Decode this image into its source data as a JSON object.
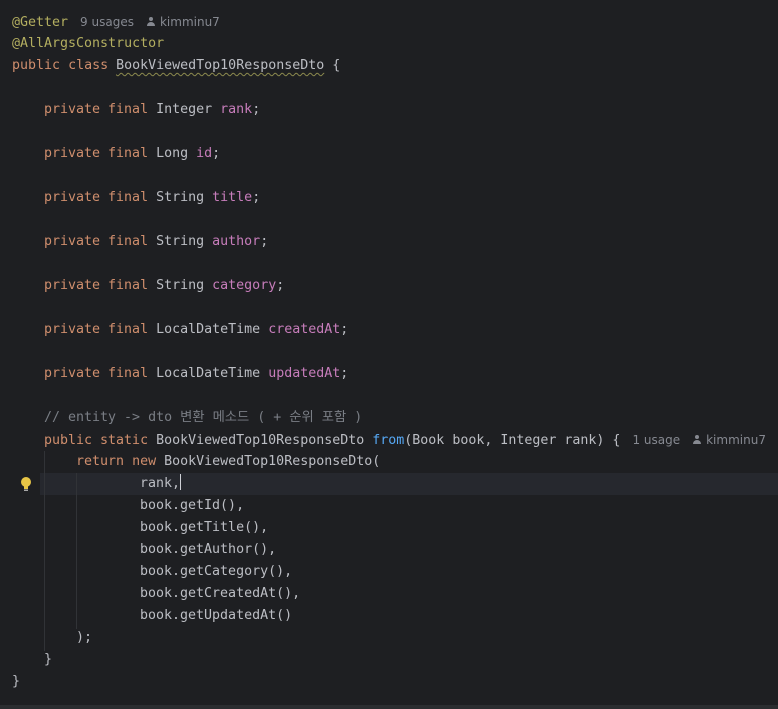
{
  "header": {
    "annotation_getter": "@Getter",
    "getter_usages": "9 usages",
    "getter_author": "kimminu7",
    "annotation_ctor": "@AllArgsConstructor",
    "kw_public": "public",
    "kw_class": "class",
    "class_name": "BookViewedTop10ResponseDto",
    "open_brace": "{"
  },
  "fields": [
    {
      "modifiers": "private final",
      "type": "Integer",
      "name": "rank"
    },
    {
      "modifiers": "private final",
      "type": "Long",
      "name": "id"
    },
    {
      "modifiers": "private final",
      "type": "String",
      "name": "title"
    },
    {
      "modifiers": "private final",
      "type": "String",
      "name": "author"
    },
    {
      "modifiers": "private final",
      "type": "String",
      "name": "category"
    },
    {
      "modifiers": "private final",
      "type": "LocalDateTime",
      "name": "createdAt"
    },
    {
      "modifiers": "private final",
      "type": "LocalDateTime",
      "name": "updatedAt"
    }
  ],
  "method": {
    "comment": "// entity -> dto 변환 메소드 ( + 순위 포함 )",
    "modifiers": "public static",
    "return_type": "BookViewedTop10ResponseDto",
    "name": "from",
    "params": "(Book book, Integer rank) {",
    "usages": "1 usage",
    "author": "kimminu7",
    "kw_return": "return",
    "kw_new": "new",
    "ctor_call": "BookViewedTop10ResponseDto(",
    "args": [
      "rank,",
      "book.getId(),",
      "book.getTitle(),",
      "book.getAuthor(),",
      "book.getCategory(),",
      "book.getCreatedAt(),",
      "book.getUpdatedAt()"
    ],
    "close_call": ");",
    "close_method": "}"
  },
  "footer": {
    "close_class": "}"
  },
  "colors": {
    "background": "#1e1f22",
    "annotation": "#b3ae60",
    "keyword": "#cf8e6d",
    "field": "#c77dbb",
    "function": "#56a8f5",
    "comment": "#7a7e85",
    "text": "#bcbec4"
  }
}
